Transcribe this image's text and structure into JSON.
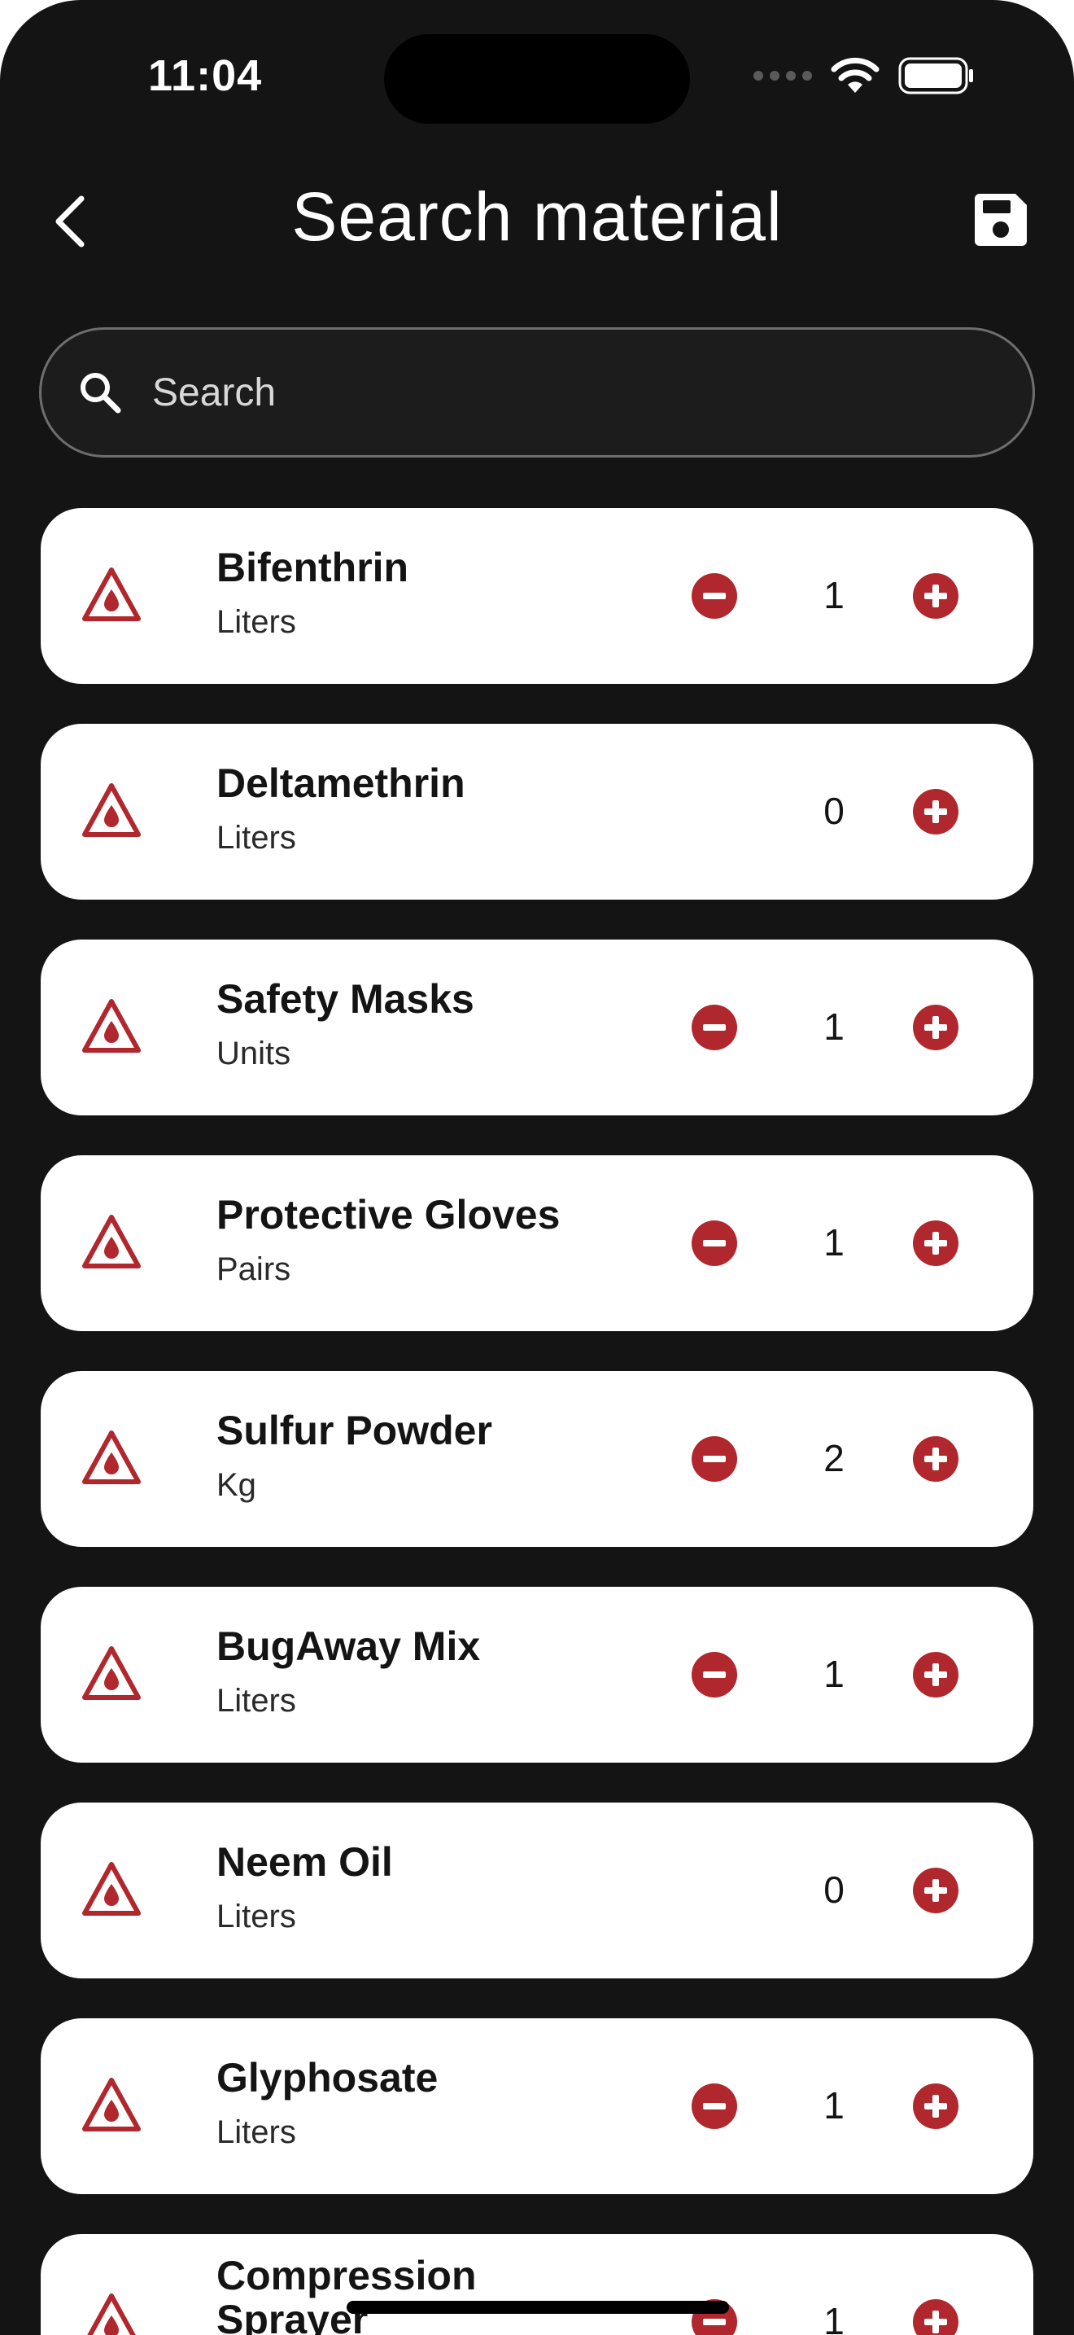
{
  "status_bar": {
    "time": "11:04"
  },
  "header": {
    "title": "Search material"
  },
  "search": {
    "placeholder": "Search"
  },
  "colors": {
    "accent": "#B0282D",
    "background": "#141414",
    "card": "#FFFFFF"
  },
  "materials": [
    {
      "name": "Bifenthrin",
      "unit": "Liters",
      "quantity": "1"
    },
    {
      "name": "Deltamethrin",
      "unit": "Liters",
      "quantity": "0"
    },
    {
      "name": "Safety Masks",
      "unit": "Units",
      "quantity": "1"
    },
    {
      "name": "Protective Gloves",
      "unit": "Pairs",
      "quantity": "1"
    },
    {
      "name": "Sulfur Powder",
      "unit": "Kg",
      "quantity": "2"
    },
    {
      "name": "BugAway Mix",
      "unit": "Liters",
      "quantity": "1"
    },
    {
      "name": "Neem Oil",
      "unit": "Liters",
      "quantity": "0"
    },
    {
      "name": "Glyphosate",
      "unit": "Liters",
      "quantity": "1"
    },
    {
      "name": "Compression Sprayer",
      "unit": "",
      "quantity": "1"
    }
  ],
  "icons": {
    "material": "hazard-droplet-icon",
    "decrease": "minus-circle-icon",
    "increase": "plus-circle-icon",
    "back": "chevron-left-icon",
    "save": "save-icon",
    "search": "search-icon"
  }
}
